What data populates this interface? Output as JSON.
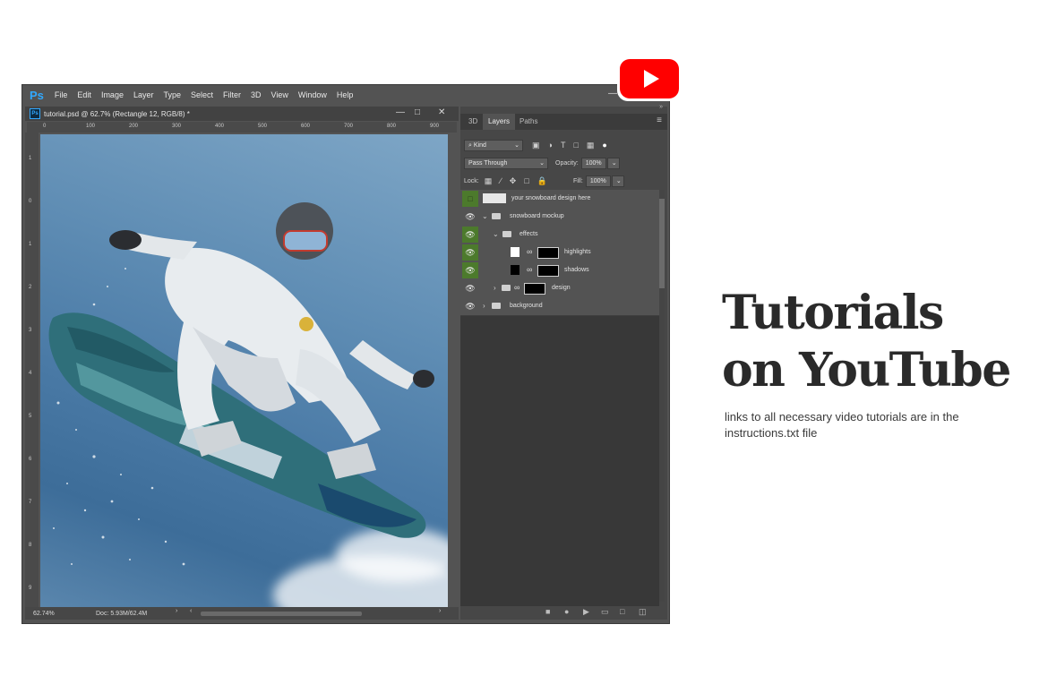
{
  "app": {
    "logo": "Ps",
    "menu": [
      "File",
      "Edit",
      "Image",
      "Layer",
      "Type",
      "Select",
      "Filter",
      "3D",
      "View",
      "Window",
      "Help"
    ]
  },
  "document": {
    "tab_title": "tutorial.psd @ 62.7% (Rectangle 12, RGB/8) *",
    "ruler_top": [
      "0",
      "100",
      "200",
      "300",
      "400",
      "500",
      "600",
      "700",
      "800",
      "900"
    ],
    "ruler_left": [
      "1",
      "0",
      "1",
      "2",
      "3",
      "4",
      "5",
      "6",
      "7",
      "8",
      "9"
    ],
    "zoom": "62.74%",
    "doc_info": "Doc: 5.93M/62.4M"
  },
  "panel": {
    "tabs": [
      "3D",
      "Layers",
      "Paths"
    ],
    "filter_kind": "Kind",
    "blend_mode": "Pass Through",
    "opacity_label": "Opacity:",
    "opacity_value": "100%",
    "lock_label": "Lock:",
    "fill_label": "Fill:",
    "fill_value": "100%",
    "layers": [
      {
        "name": "your snowboard design here"
      },
      {
        "name": "snowboard mockup"
      },
      {
        "name": "effects"
      },
      {
        "name": "highlights"
      },
      {
        "name": "shadows"
      },
      {
        "name": "design"
      },
      {
        "name": "background"
      }
    ]
  },
  "promo": {
    "title_line1": "Tutorials",
    "title_line2": "on YouTube",
    "subtitle": "links to all necessary video tutorials are in the instructions.txt file"
  },
  "colors": {
    "youtube_red": "#ff0000",
    "ps_blue": "#31a8ff",
    "visibility_green": "#4c7a2c"
  }
}
